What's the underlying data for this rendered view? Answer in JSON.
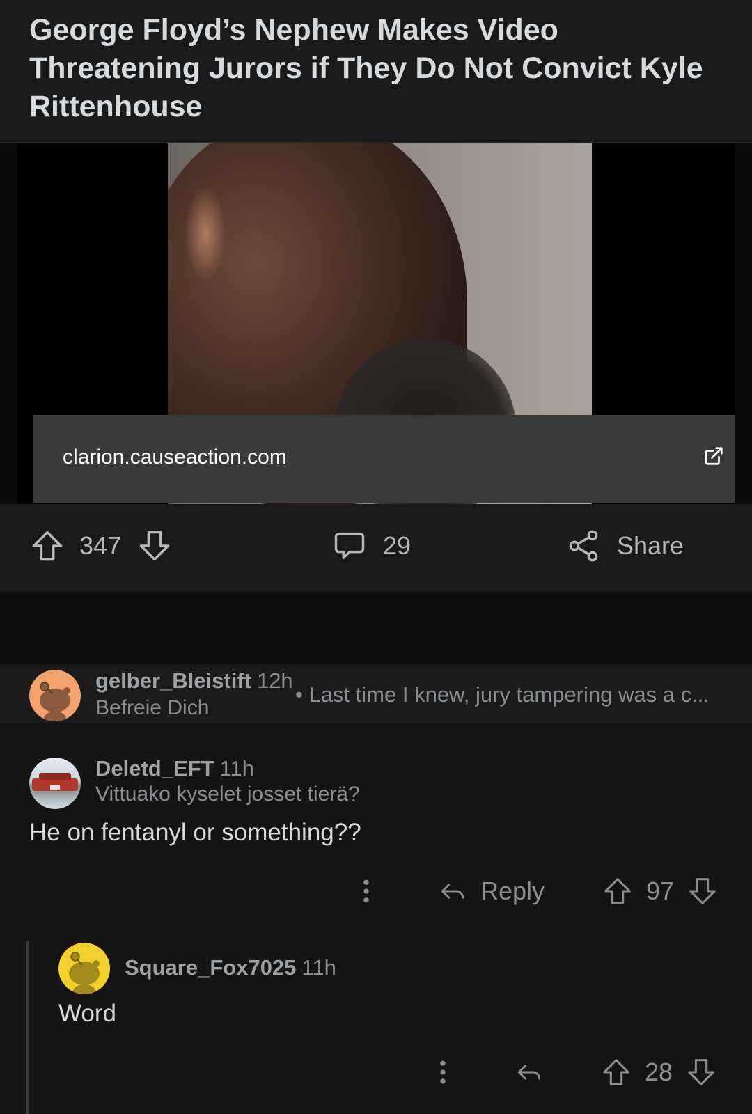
{
  "post": {
    "title": "George Floyd’s Nephew Makes Video Threatening Jurors if They Do Not Convict Kyle Rittenhouse",
    "link_domain": "clarion.causeaction.com",
    "score": "347",
    "comments": "29",
    "share_label": "Share"
  },
  "comments": [
    {
      "username": "gelber_Bleistift",
      "time": "12h",
      "flair": "Befreie Dich",
      "preview": "• Last time I knew, jury tampering was a c...",
      "avatar_color": "#f1a36b",
      "collapsed": true
    },
    {
      "username": "Deletd_EFT",
      "time": "11h",
      "flair": "Vittuako kyselet josset tierä?",
      "body": "He on fentanyl or something??",
      "reply_label": "Reply",
      "score": "97"
    },
    {
      "username": "Square_Fox7025",
      "time": "11h",
      "body": "Word",
      "score": "28",
      "avatar_color": "#f2cf2b"
    }
  ],
  "colors": {
    "background": "#141414",
    "card": "#1a1a1b",
    "link_bar": "#3a3a3b",
    "text": "#d7dadc",
    "muted": "#8a8e91"
  },
  "icons": [
    "upvote-icon",
    "downvote-icon",
    "comment-icon",
    "share-icon",
    "external-link-icon",
    "reply-icon",
    "more-vertical-icon",
    "snoo-avatar-icon"
  ]
}
